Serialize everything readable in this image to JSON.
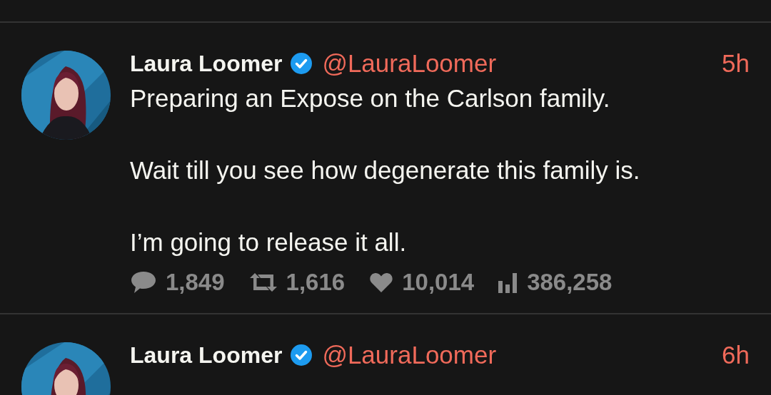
{
  "posts": [
    {
      "name": "Laura Loomer",
      "verified": true,
      "handle": "@LauraLoomer",
      "time": "5h",
      "avatar": {
        "kind": "picture"
      },
      "paragraphs": [
        "Preparing an Expose on the Carlson family.",
        "Wait till you see how degenerate this family is.",
        "I’m going to release it all."
      ],
      "stats": [
        {
          "kind": "reply",
          "count": "1,849"
        },
        {
          "kind": "repost",
          "count": "1,616"
        },
        {
          "kind": "like",
          "count": "10,014"
        },
        {
          "kind": "views",
          "count": "386,258"
        }
      ]
    },
    {
      "name": "Laura Loomer",
      "verified": true,
      "handle": "@LauraLoomer",
      "time": "6h",
      "avatar": {
        "kind": "picture"
      }
    }
  ]
}
